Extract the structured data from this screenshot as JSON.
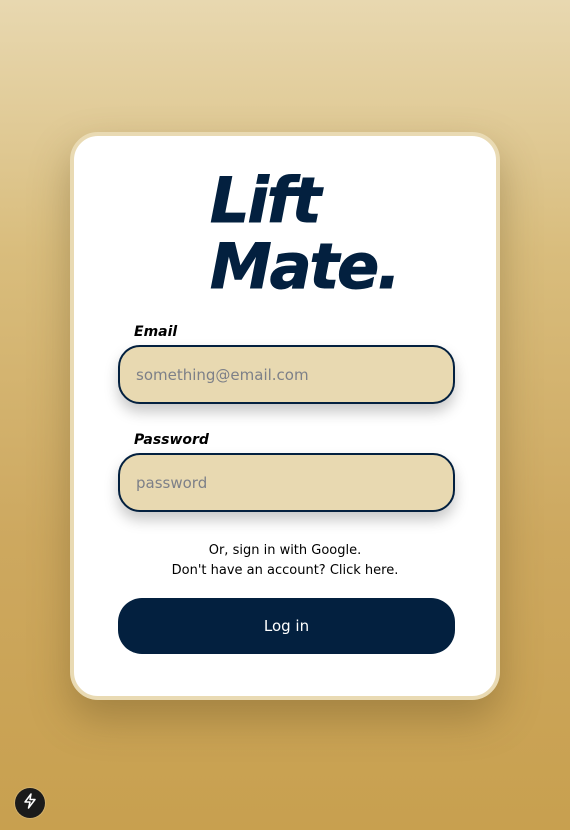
{
  "logo": {
    "line1": "Lift",
    "line2": "Mate."
  },
  "form": {
    "email": {
      "label": "Email",
      "placeholder": "something@email.com"
    },
    "password": {
      "label": "Password",
      "placeholder": "password"
    },
    "google_link": "Or, sign in with Google.",
    "signup_link": "Don't have an account? Click here.",
    "login_button": "Log in"
  },
  "dev_indicator": {
    "icon": "lightning-bolt-icon"
  },
  "colors": {
    "navy": "#03203f",
    "sand": "#e8d9b1",
    "card": "#ffffff",
    "background_top": "#e8d8b0",
    "background_bottom": "#c8a04f"
  }
}
